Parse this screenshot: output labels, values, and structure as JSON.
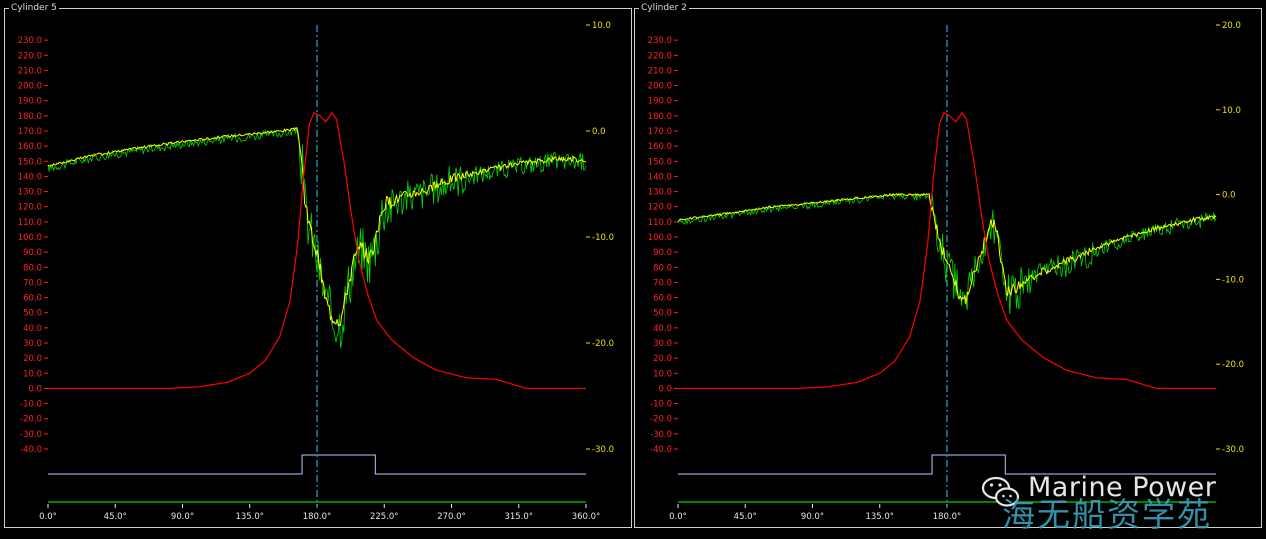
{
  "panels": [
    {
      "title": "Cylinder 5"
    },
    {
      "title": "Cylinder 2"
    }
  ],
  "watermark": {
    "text": "Marine Power",
    "cn": "海无船资学苑",
    "icon": "wechat-icon"
  },
  "colors": {
    "pressure": "#ff0000",
    "vibration_raw": "#00ff00",
    "vibration_filtered": "#ffff00",
    "cursor": "#2aa8c8",
    "gate": "#b8c8ff",
    "baseline": "#00b000",
    "left_axis": "#ff2020",
    "right_axis": "#e6e600",
    "x_axis": "#e6e6e6"
  },
  "chart_data": [
    {
      "type": "line",
      "panel": "Cylinder 5",
      "x_unit": "crank angle (°)",
      "xlim": [
        0,
        360
      ],
      "x_ticks": [
        "0.0°",
        "45.0°",
        "90.0°",
        "135.0°",
        "180.0°",
        "225.0°",
        "270.0°",
        "315.0°",
        "360.0°"
      ],
      "y_left": {
        "lim": [
          -40,
          240
        ],
        "ticks": [
          "230.0",
          "220.0",
          "210.0",
          "200.0",
          "190.0",
          "180.0",
          "170.0",
          "160.0",
          "150.0",
          "140.0",
          "130.0",
          "120.0",
          "110.0",
          "100.0",
          "90.0",
          "80.0",
          "70.0",
          "60.0",
          "50.0",
          "40.0",
          "30.0",
          "20.0",
          "10.0",
          "0.0",
          "-10.0",
          "-20.0",
          "-30.0",
          "-40.0"
        ]
      },
      "y_right": {
        "lim": [
          -30,
          10
        ],
        "ticks": [
          "10.0",
          "0.0",
          "-10.0",
          "-20.0",
          "-30.0"
        ]
      },
      "cursor_x": 180,
      "gate": {
        "on": 170,
        "off": 219
      },
      "series": [
        {
          "axis": "left",
          "points": [
            [
              0,
              0
            ],
            [
              80,
              0
            ],
            [
              100,
              1
            ],
            [
              120,
              4
            ],
            [
              135,
              10
            ],
            [
              145,
              18
            ],
            [
              155,
              34
            ],
            [
              162,
              58
            ],
            [
              167,
              95
            ],
            [
              171,
              140
            ],
            [
              175,
              175
            ],
            [
              178,
              182
            ],
            [
              182,
              180
            ],
            [
              186,
              176
            ],
            [
              190,
              182
            ],
            [
              193,
              178
            ],
            [
              198,
              150
            ],
            [
              203,
              115
            ],
            [
              208,
              85
            ],
            [
              214,
              62
            ],
            [
              220,
              45
            ],
            [
              230,
              32
            ],
            [
              245,
              20
            ],
            [
              260,
              12
            ],
            [
              280,
              7
            ],
            [
              300,
              6
            ],
            [
              310,
              3
            ],
            [
              320,
              0
            ],
            [
              360,
              0
            ]
          ]
        },
        {
          "axis": "right",
          "points": [
            [
              0,
              -3.3
            ],
            [
              30,
              -2.3
            ],
            [
              60,
              -1.6
            ],
            [
              90,
              -1
            ],
            [
              120,
              -0.5
            ],
            [
              155,
              0
            ],
            [
              167,
              0.2
            ],
            [
              170,
              -3
            ],
            [
              172,
              -7
            ],
            [
              175,
              -9
            ],
            [
              178,
              -10.5
            ],
            [
              182,
              -13
            ],
            [
              186,
              -16
            ],
            [
              190,
              -17.5
            ],
            [
              196,
              -17.8
            ],
            [
              200,
              -15
            ],
            [
              205,
              -12
            ],
            [
              210,
              -11
            ],
            [
              215,
              -12
            ],
            [
              220,
              -10
            ],
            [
              224,
              -7
            ],
            [
              232,
              -6.5
            ],
            [
              240,
              -6
            ],
            [
              255,
              -5.5
            ],
            [
              270,
              -4.5
            ],
            [
              285,
              -4
            ],
            [
              300,
              -3.5
            ],
            [
              320,
              -3
            ],
            [
              340,
              -2.6
            ],
            [
              360,
              -2.7
            ]
          ]
        }
      ]
    },
    {
      "type": "line",
      "panel": "Cylinder 2",
      "x_unit": "crank angle (°)",
      "xlim": [
        0,
        360
      ],
      "x_ticks": [
        "0.0°",
        "45.0°",
        "90.0°",
        "135.0°",
        "180.0°"
      ],
      "y_left": {
        "lim": [
          -40,
          240
        ],
        "ticks": [
          "230.0",
          "220.0",
          "210.0",
          "200.0",
          "190.0",
          "180.0",
          "170.0",
          "160.0",
          "150.0",
          "140.0",
          "130.0",
          "120.0",
          "110.0",
          "100.0",
          "90.0",
          "80.0",
          "70.0",
          "60.0",
          "50.0",
          "40.0",
          "30.0",
          "20.0",
          "10.0",
          "0.0",
          "-10.0",
          "-20.0",
          "-30.0",
          "-40.0"
        ]
      },
      "y_right": {
        "lim": [
          -30,
          20
        ],
        "ticks": [
          "20.0",
          "10.0",
          "0.0",
          "-10.0",
          "-20.0",
          "-30.0"
        ]
      },
      "cursor_x": 180,
      "gate": {
        "on": 170,
        "off": 219
      },
      "series": [
        {
          "axis": "left",
          "points": [
            [
              0,
              0
            ],
            [
              80,
              0
            ],
            [
              100,
              1
            ],
            [
              120,
              4
            ],
            [
              135,
              10
            ],
            [
              145,
              18
            ],
            [
              155,
              34
            ],
            [
              162,
              58
            ],
            [
              167,
              95
            ],
            [
              171,
              140
            ],
            [
              175,
              175
            ],
            [
              178,
              182
            ],
            [
              182,
              180
            ],
            [
              186,
              176
            ],
            [
              190,
              182
            ],
            [
              193,
              178
            ],
            [
              198,
              150
            ],
            [
              203,
              115
            ],
            [
              208,
              85
            ],
            [
              214,
              62
            ],
            [
              220,
              45
            ],
            [
              230,
              32
            ],
            [
              245,
              20
            ],
            [
              260,
              12
            ],
            [
              280,
              7
            ],
            [
              300,
              6
            ],
            [
              320,
              0
            ],
            [
              360,
              0
            ]
          ]
        },
        {
          "axis": "right",
          "points": [
            [
              0,
              -3
            ],
            [
              30,
              -2.3
            ],
            [
              60,
              -1.5
            ],
            [
              90,
              -1
            ],
            [
              120,
              -0.4
            ],
            [
              145,
              0
            ],
            [
              168,
              0
            ],
            [
              172,
              -3
            ],
            [
              176,
              -6
            ],
            [
              180,
              -8
            ],
            [
              185,
              -10
            ],
            [
              190,
              -12.5
            ],
            [
              193,
              -12.2
            ],
            [
              197,
              -10
            ],
            [
              202,
              -7
            ],
            [
              207,
              -5
            ],
            [
              210,
              -3
            ],
            [
              213,
              -4
            ],
            [
              216,
              -8
            ],
            [
              220,
              -11.5
            ],
            [
              230,
              -10.5
            ],
            [
              245,
              -9
            ],
            [
              265,
              -7.5
            ],
            [
              285,
              -6
            ],
            [
              300,
              -5
            ],
            [
              320,
              -4
            ],
            [
              345,
              -3
            ],
            [
              360,
              -2.5
            ]
          ]
        }
      ]
    }
  ]
}
